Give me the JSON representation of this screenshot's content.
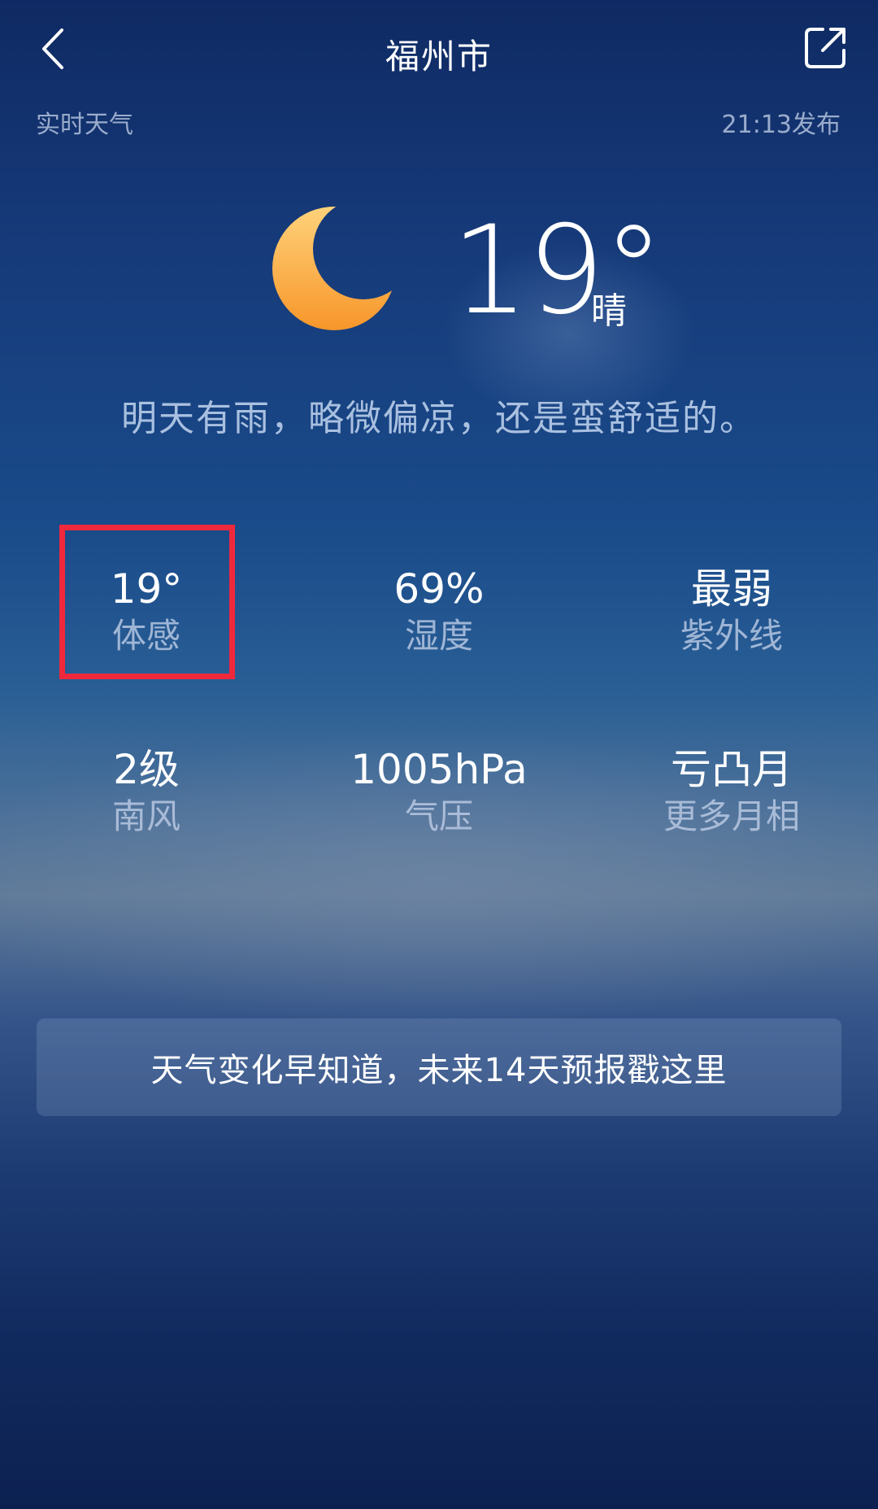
{
  "header": {
    "title": "福州市",
    "back_icon": "chevron-left-icon",
    "share_icon": "share-icon"
  },
  "subheader": {
    "left_text": "实时天气",
    "right_text": "21:13发布"
  },
  "current": {
    "icon": "moon-icon",
    "temperature": "19°",
    "condition": "晴",
    "summary": "明天有雨，略微偏凉，还是蛮舒适的。"
  },
  "metrics": [
    {
      "value": "19°",
      "label": "体感"
    },
    {
      "value": "69%",
      "label": "湿度"
    },
    {
      "value": "最弱",
      "label": "紫外线"
    },
    {
      "value": "2级",
      "label": "南风"
    },
    {
      "value": "1005hPa",
      "label": "气压"
    },
    {
      "value": "亏凸月",
      "label": "更多月相"
    }
  ],
  "forecast_banner": {
    "text": "天气变化早知道，未来14天预报戳这里"
  },
  "colors": {
    "highlight": "#f0283c",
    "moon_top": "#ffd27a",
    "moon_bottom": "#f7962a"
  }
}
